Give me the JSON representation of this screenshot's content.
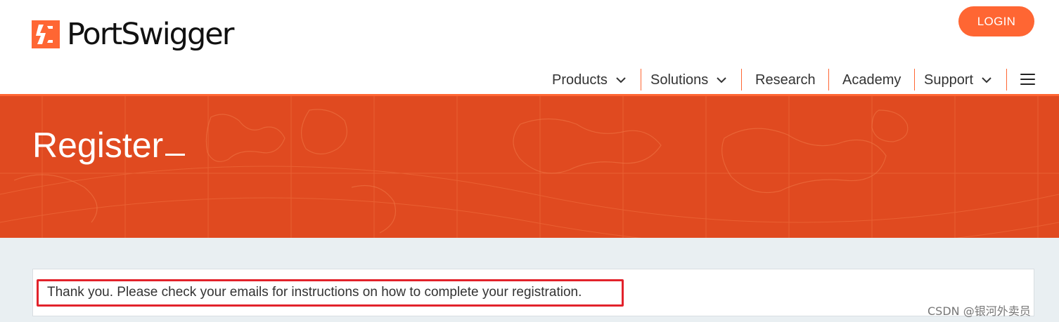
{
  "header": {
    "brand": "PortSwigger",
    "login_label": "LOGIN",
    "nav": [
      {
        "label": "Products",
        "has_dropdown": true
      },
      {
        "label": "Solutions",
        "has_dropdown": true
      },
      {
        "label": "Research",
        "has_dropdown": false
      },
      {
        "label": "Academy",
        "has_dropdown": false
      },
      {
        "label": "Support",
        "has_dropdown": true
      }
    ],
    "menu_icon": "hamburger-menu-icon"
  },
  "hero": {
    "title": "Register"
  },
  "message": {
    "text": "Thank you. Please check your emails for instructions on how to complete your registration."
  },
  "watermark": "CSDN @银河外卖员",
  "colors": {
    "brand_orange": "#ff6633",
    "hero_bg": "#e04a20",
    "content_bg": "#e9eff2",
    "highlight_red": "#e2222b"
  }
}
